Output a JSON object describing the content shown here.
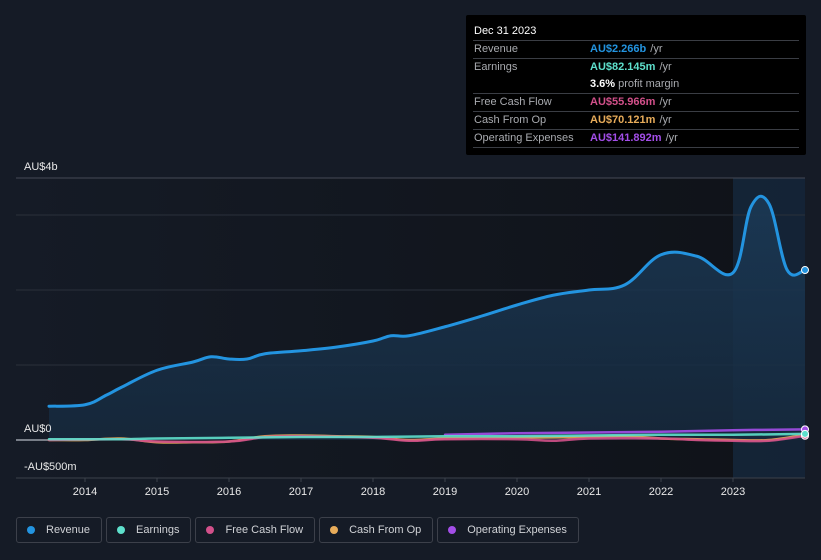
{
  "tooltip": {
    "date": "Dec 31 2023",
    "rows": [
      {
        "label": "Revenue",
        "value": "AU$2.266b",
        "unit": "/yr",
        "color": "#2394e0"
      },
      {
        "label": "Earnings",
        "value": "AU$82.145m",
        "unit": "/yr",
        "color": "#5ee0cc"
      },
      {
        "label": "Free Cash Flow",
        "value": "AU$55.966m",
        "unit": "/yr",
        "color": "#d2508a"
      },
      {
        "label": "Cash From Op",
        "value": "AU$70.121m",
        "unit": "/yr",
        "color": "#e8ac5a"
      },
      {
        "label": "Operating Expenses",
        "value": "AU$141.892m",
        "unit": "/yr",
        "color": "#a34ee8"
      }
    ],
    "profit_margin_value": "3.6%",
    "profit_margin_text": "profit margin"
  },
  "legend": [
    {
      "label": "Revenue",
      "color": "#2394e0"
    },
    {
      "label": "Earnings",
      "color": "#5ee0cc"
    },
    {
      "label": "Free Cash Flow",
      "color": "#d2508a"
    },
    {
      "label": "Cash From Op",
      "color": "#e8ac5a"
    },
    {
      "label": "Operating Expenses",
      "color": "#a34ee8"
    }
  ],
  "chart_data": {
    "type": "area",
    "title": "",
    "xlabel": "",
    "ylabel": "",
    "y_tick_labels": [
      "AU$4b",
      "AU$0",
      "-AU$500m"
    ],
    "x_tick_labels": [
      "2014",
      "2015",
      "2016",
      "2017",
      "2018",
      "2019",
      "2020",
      "2021",
      "2022",
      "2023"
    ],
    "x_ticks": [
      2014,
      2015,
      2016,
      2017,
      2018,
      2019,
      2020,
      2021,
      2022,
      2023
    ],
    "xlim": [
      2013.5,
      2024.0
    ],
    "ylim_billions": [
      -0.5,
      3.5
    ],
    "grid": true,
    "highlight_start": 2023.0,
    "units": "AU$ billions",
    "series": [
      {
        "name": "Revenue",
        "color": "#2394e0",
        "x": [
          2013.5,
          2014.0,
          2014.3,
          2014.5,
          2015.0,
          2015.5,
          2015.75,
          2016.0,
          2016.25,
          2016.5,
          2017.0,
          2017.5,
          2018.0,
          2018.25,
          2018.5,
          2019.0,
          2019.5,
          2020.0,
          2020.5,
          2021.0,
          2021.5,
          2022.0,
          2022.5,
          2023.0,
          2023.25,
          2023.5,
          2023.75,
          2024.0
        ],
        "values": [
          0.45,
          0.47,
          0.6,
          0.7,
          0.93,
          1.04,
          1.11,
          1.08,
          1.08,
          1.15,
          1.19,
          1.24,
          1.32,
          1.39,
          1.39,
          1.51,
          1.65,
          1.8,
          1.93,
          2.0,
          2.07,
          2.47,
          2.45,
          2.23,
          3.11,
          3.15,
          2.27,
          2.266
        ]
      },
      {
        "name": "Earnings",
        "color": "#5ee0cc",
        "x": [
          2013.5,
          2014.5,
          2015.0,
          2016.0,
          2017.0,
          2018.0,
          2019.0,
          2020.0,
          2021.0,
          2022.0,
          2023.0,
          2024.0
        ],
        "values": [
          0.01,
          0.01,
          0.02,
          0.03,
          0.04,
          0.04,
          0.05,
          0.05,
          0.06,
          0.07,
          0.07,
          0.082
        ]
      },
      {
        "name": "Free Cash Flow",
        "color": "#d2508a",
        "x": [
          2013.5,
          2014.5,
          2015.0,
          2016.0,
          2016.5,
          2017.0,
          2018.0,
          2018.5,
          2019.0,
          2020.0,
          2020.5,
          2021.0,
          2022.0,
          2022.5,
          2023.0,
          2023.5,
          2024.0
        ],
        "values": [
          0.0,
          0.01,
          -0.02,
          -0.02,
          0.04,
          0.05,
          0.03,
          -0.01,
          0.01,
          0.01,
          -0.01,
          0.02,
          0.02,
          0.0,
          -0.01,
          -0.01,
          0.056
        ]
      },
      {
        "name": "Cash From Op",
        "color": "#e8ac5a",
        "x": [
          2013.5,
          2014.0,
          2014.5,
          2015.0,
          2015.5,
          2016.0,
          2016.5,
          2017.0,
          2017.5,
          2018.0,
          2018.5,
          2019.0,
          2020.0,
          2021.0,
          2021.5,
          2022.0,
          2022.5,
          2023.0,
          2023.5,
          2024.0
        ],
        "values": [
          0.0,
          0.0,
          0.02,
          -0.03,
          -0.03,
          -0.02,
          0.05,
          0.06,
          0.05,
          0.04,
          0.0,
          0.02,
          0.03,
          0.04,
          0.05,
          0.02,
          0.01,
          0.0,
          0.0,
          0.07
        ]
      },
      {
        "name": "Operating Expenses",
        "color": "#a34ee8",
        "x": [
          2019.0,
          2020.0,
          2021.0,
          2022.0,
          2023.0,
          2024.0
        ],
        "values": [
          0.07,
          0.09,
          0.1,
          0.11,
          0.13,
          0.142
        ]
      }
    ]
  }
}
